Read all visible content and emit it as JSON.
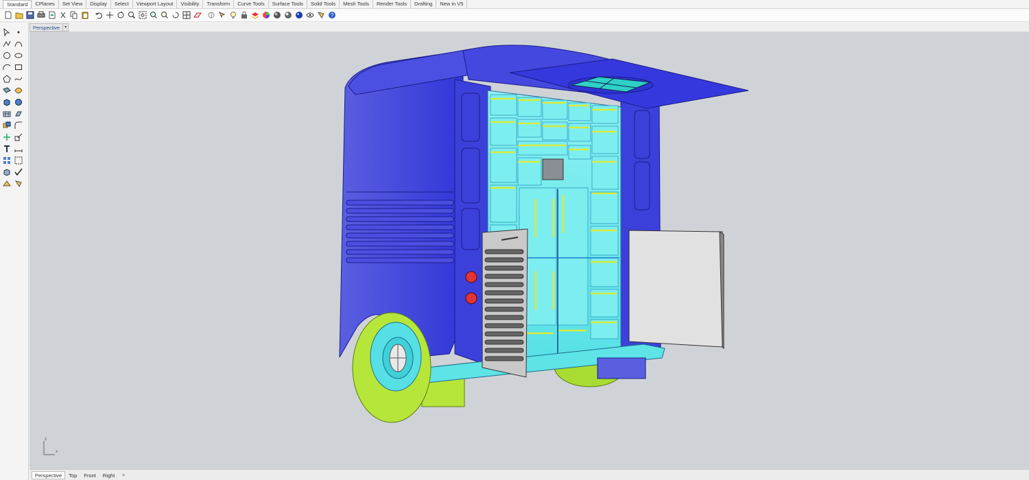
{
  "menu_tabs": [
    "Standard",
    "CPlanes",
    "Set View",
    "Display",
    "Select",
    "Viewport Layout",
    "Visibility",
    "Transform",
    "Curve Tools",
    "Surface Tools",
    "Solid Tools",
    "Mesh Tools",
    "Render Tools",
    "Drafting",
    "New in V5"
  ],
  "active_menu_tab": "Standard",
  "toolbar_icons": [
    "new-file-icon",
    "open-icon",
    "save-icon",
    "print-icon",
    "import-icon",
    "cut-icon",
    "copy-icon",
    "paste-icon",
    "undo-icon",
    "pan-icon",
    "rotate-view-icon",
    "zoom-icon",
    "zoom-window-icon",
    "zoom-extents-icon",
    "zoom-selected-icon",
    "undo-view-icon",
    "four-viewports-icon",
    "cplane-icon",
    "grid-snap-icon",
    "select-icon",
    "lightbulb-icon",
    "lock-icon",
    "layer-icon",
    "color-wheel-icon",
    "shaded-sphere-icon",
    "rendered-sphere-icon",
    "render-icon",
    "hide-icon",
    "light-icon",
    "help-icon"
  ],
  "sidebar_icons": [
    "select-arrow-icon",
    "point-icon",
    "polyline-icon",
    "curve-icon",
    "circle-icon",
    "ellipse-icon",
    "arc-icon",
    "rectangle-icon",
    "polygon-icon",
    "freeform-icon",
    "surface-icon",
    "surface-patch-icon",
    "box-icon",
    "sphere-icon",
    "mesh-icon",
    "extrude-icon",
    "boolean-icon",
    "fillet-icon",
    "move-icon",
    "scale-icon",
    "text-icon",
    "dimension-icon",
    "array-icon",
    "group-icon",
    "block-icon",
    "check-icon",
    "analyze-icon",
    "render-icon"
  ],
  "viewport": {
    "title": "Perspective",
    "axis_labels": {
      "z": "z",
      "x": "x",
      "y": "y"
    }
  },
  "bottom_tabs": [
    "Perspective",
    "Top",
    "Front",
    "Right"
  ],
  "active_bottom_tab": "Perspective",
  "colors": {
    "viewport_bg": "#cfd3d7",
    "body_blue": "#3b3ddc",
    "panel_cyan": "#62e8e8",
    "tire_green": "#b6e63a",
    "highlight_yellow": "#d8ea3a",
    "door_gray": "#dcdcdc"
  }
}
